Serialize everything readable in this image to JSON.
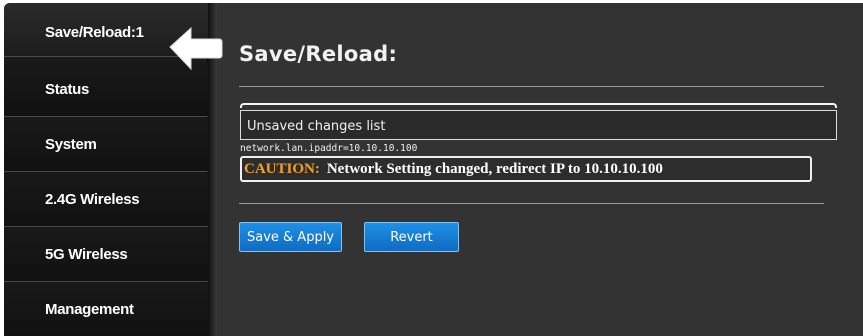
{
  "sidebar": {
    "items": [
      {
        "label": "Save/Reload:1",
        "active": true
      },
      {
        "label": "Status"
      },
      {
        "label": "System"
      },
      {
        "label": "2.4G Wireless"
      },
      {
        "label": "5G Wireless"
      },
      {
        "label": "Management"
      }
    ]
  },
  "main": {
    "title": "Save/Reload:",
    "changes": {
      "header": "Unsaved changes list",
      "line": "network.lan.ipaddr=10.10.10.100"
    },
    "caution": {
      "label": "CAUTION:",
      "message": "Network Setting changed, redirect IP to  10.10.10.100"
    },
    "buttons": {
      "save_apply": "Save & Apply",
      "revert": "Revert"
    }
  },
  "colors": {
    "accent_blue": "#1a7fd8",
    "caution_orange": "#f4a11e",
    "background": "#333333"
  },
  "icons": {
    "pointer": "white-arrow-left-icon"
  }
}
